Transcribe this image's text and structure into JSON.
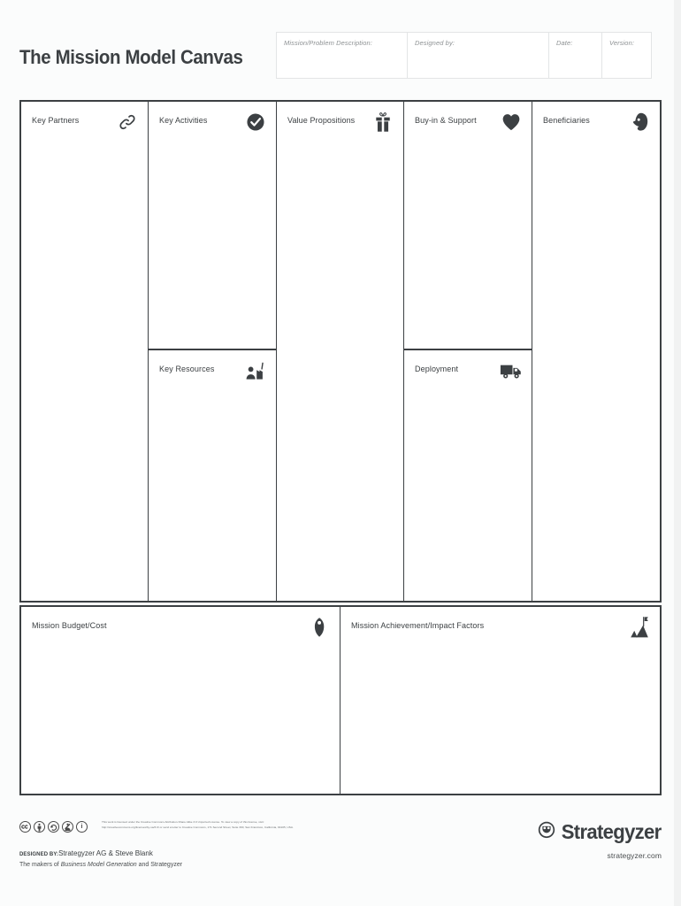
{
  "document": {
    "title": "The Mission Model Canvas"
  },
  "header": {
    "fields": [
      {
        "label": "Mission/Problem Description:",
        "value": ""
      },
      {
        "label": "Designed by:",
        "value": ""
      },
      {
        "label": "Date:",
        "value": ""
      },
      {
        "label": "Version:",
        "value": ""
      }
    ]
  },
  "canvas": {
    "blocks": [
      {
        "id": "key-partners",
        "label": "Key Partners",
        "icon": "chain-link-icon",
        "content": ""
      },
      {
        "id": "key-activities",
        "label": "Key Activities",
        "icon": "check-circle-icon",
        "content": ""
      },
      {
        "id": "key-resources",
        "label": "Key Resources",
        "icon": "factory-worker-icon",
        "content": ""
      },
      {
        "id": "value-propositions",
        "label": "Value Propositions",
        "icon": "gift-icon",
        "content": ""
      },
      {
        "id": "buy-in-support",
        "label": "Buy-in & Support",
        "icon": "heart-icon",
        "content": ""
      },
      {
        "id": "deployment",
        "label": "Deployment",
        "icon": "delivery-truck-icon",
        "content": ""
      },
      {
        "id": "beneficiaries",
        "label": "Beneficiaries",
        "icon": "head-profile-icon",
        "content": ""
      },
      {
        "id": "mission-budget-cost",
        "label": "Mission Budget/Cost",
        "icon": "price-tag-icon",
        "content": ""
      },
      {
        "id": "mission-achievement",
        "label": "Mission Achievement/Impact Factors",
        "icon": "mountain-flag-icon",
        "content": ""
      }
    ]
  },
  "footer": {
    "cc_badges": [
      "cc",
      "BY",
      "SA",
      "person",
      "i"
    ],
    "license_line1": "This work is licensed under the Creative Commons Attribution-Share Alike 3.0 Unported License. To view a copy of this license, visit:",
    "license_line2": "http://creativecommons.org/licenses/by-sa/3.0/ or send a letter to Creative Commons, 171 Second Street, Suite 300, San Francisco, California, 94105, USA.",
    "designed_by_label": "DESIGNED BY:",
    "designed_by_names": "Strategyzer AG & Steve Blank",
    "makers_prefix": "The makers of ",
    "makers_italic": "Business Model Generation",
    "makers_suffix": " and Strategyzer",
    "brand_name": "Strategyzer",
    "brand_url": "strategyzer.com"
  },
  "colors": {
    "ink": "#3c4043",
    "page_background": "#fbfcfc",
    "card_background": "#ffffff",
    "meta_border": "#e3e5e6",
    "muted_text": "#8d9193"
  }
}
